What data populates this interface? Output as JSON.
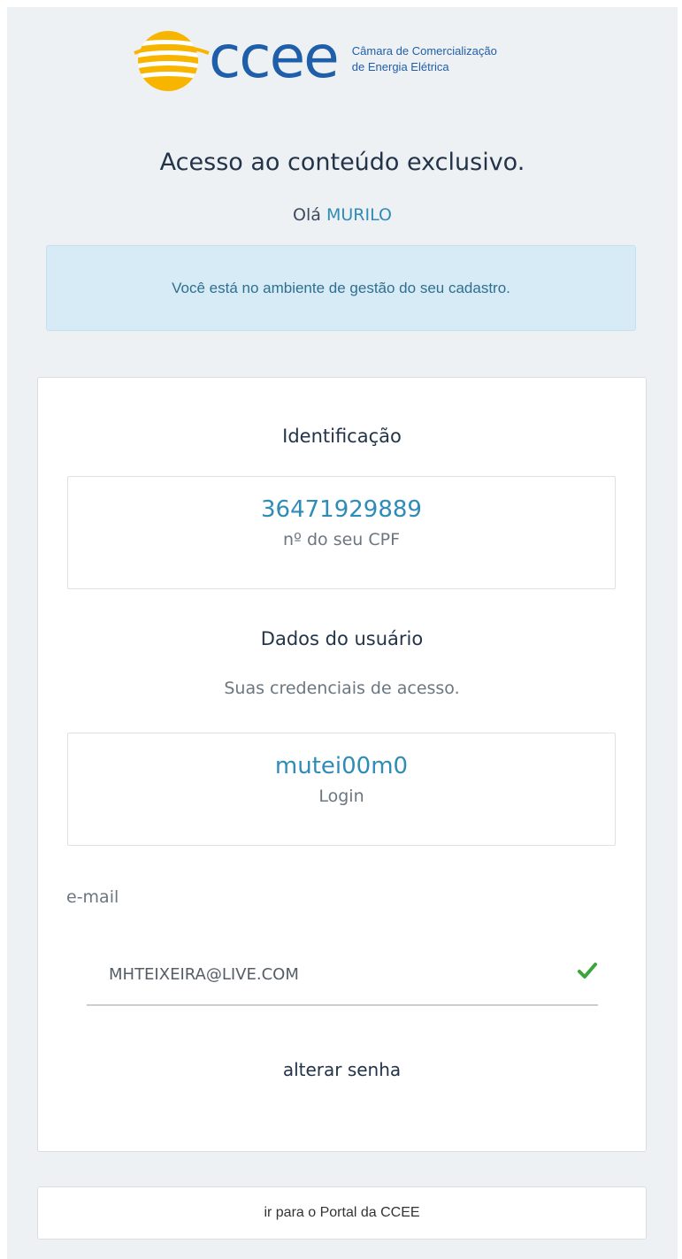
{
  "brand": {
    "wordmark": "ccee",
    "tagline_line1": "Câmara de Comercialização",
    "tagline_line2": "de Energia Elétrica",
    "logo_icon": "ccee-sun-logo-icon",
    "accent": "#1f5ea8",
    "sun_color": "#f7b500"
  },
  "header": {
    "title": "Acesso ao conteúdo exclusivo.",
    "greeting_prefix": "Olá",
    "user_name": "MURILO"
  },
  "alert": {
    "message": "Você está no ambiente de gestão do seu cadastro."
  },
  "identification": {
    "title": "Identificação",
    "cpf_value": "36471929889",
    "cpf_label": "nº do seu CPF"
  },
  "user_data": {
    "title": "Dados do usuário",
    "description": "Suas credenciais de acesso.",
    "login_value": "mutei00m0",
    "login_label": "Login"
  },
  "email": {
    "label": "e-mail",
    "value": "MHTEIXEIRA@LIVE.COM",
    "status_icon": "check-icon",
    "status_color": "#3aa53a"
  },
  "actions": {
    "change_password": "alterar senha",
    "portal_button": "ir para o Portal da CCEE"
  }
}
